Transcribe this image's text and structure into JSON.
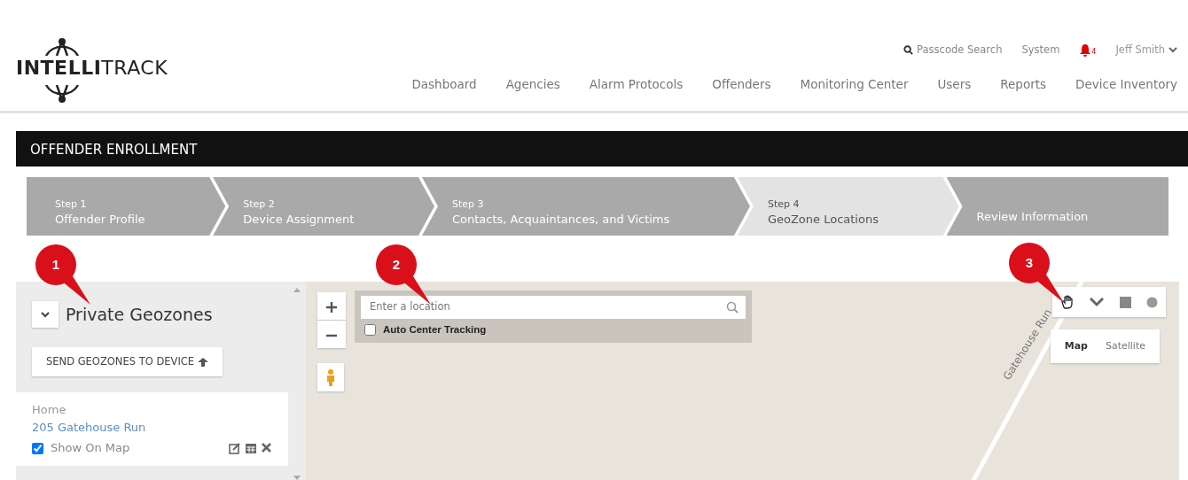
{
  "header": {
    "logo_text": {
      "bold": "INTELLI",
      "light": "TRACK"
    },
    "top_links": [
      {
        "kind": "search",
        "label": "Passcode Search"
      },
      {
        "kind": "text",
        "label": "System"
      },
      {
        "kind": "bell",
        "label": "4"
      },
      {
        "kind": "user",
        "label": "Jeff Smith"
      }
    ],
    "nav": [
      "Dashboard",
      "Agencies",
      "Alarm Protocols",
      "Offenders",
      "Monitoring Center",
      "Users",
      "Reports",
      "Device Inventory"
    ]
  },
  "page_title": "OFFENDER ENROLLMENT",
  "steps": [
    {
      "step": "Step 1",
      "label": "Offender Profile",
      "selected": false
    },
    {
      "step": "Step 2",
      "label": "Device Assignment",
      "selected": false
    },
    {
      "step": "Step 3",
      "label": "Contacts, Acquaintances, and Victims",
      "selected": false
    },
    {
      "step": "Step 4",
      "label": "GeoZone Locations",
      "selected": true
    },
    {
      "label": "Review Information",
      "selected": false
    }
  ],
  "sidebar": {
    "title": "Private Geozones",
    "send_button": "SEND GEOZONES TO DEVICE",
    "geozones": [
      {
        "name": "Home",
        "address": "205 Gatehouse Run",
        "show_on_map": {
          "label": "Show On Map",
          "checked": true
        }
      }
    ]
  },
  "map": {
    "search": {
      "placeholder": "Enter a location"
    },
    "auto_center": {
      "label": "Auto Center Tracking",
      "checked": false
    },
    "road_label": "Gatehouse Run",
    "map_types": [
      {
        "label": "Map",
        "selected": true
      },
      {
        "label": "Satellite",
        "selected": false
      }
    ]
  },
  "callouts": [
    "1",
    "2",
    "3"
  ]
}
